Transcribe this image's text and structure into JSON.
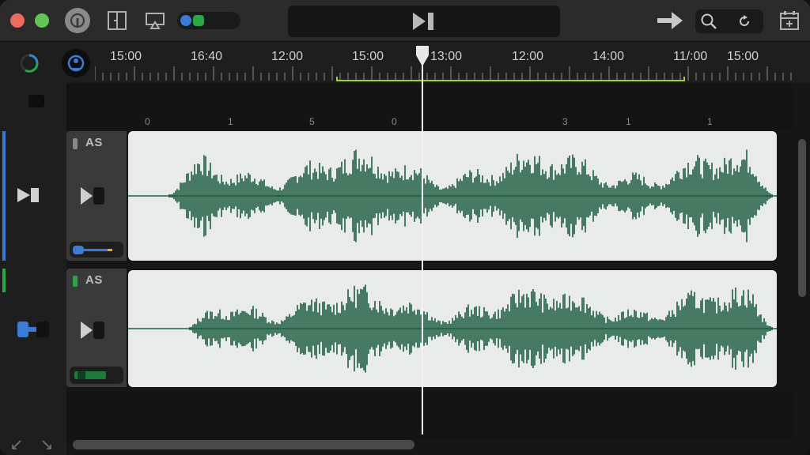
{
  "colors": {
    "close": "#ee6a5f",
    "minimize": "#f5bf4f",
    "zoom": "#61c554",
    "waveform": "#1e5e3f",
    "track1_accent": "#3a7bd5",
    "track2_accent": "#28a745",
    "cycle": "#9ad13a"
  },
  "toolbar": {
    "icons": [
      "library-icon",
      "smart-controls-icon",
      "airplay-icon",
      "track-toggle-icon",
      "play-pause-icon",
      "forward-arrow-icon",
      "search-icon",
      "refresh-icon",
      "add-track-icon"
    ]
  },
  "ruler": {
    "time_labels": [
      "15:00",
      "16:40",
      "12:00",
      "15:00",
      "13:00",
      "12:00",
      "14:00",
      "11/:00",
      "15:00"
    ],
    "beat_labels": [
      "0",
      "1",
      "5",
      "0",
      "3",
      "1",
      "1"
    ]
  },
  "tracks": [
    {
      "name": "AS",
      "accent": "blue",
      "level": 0.75
    },
    {
      "name": "AS",
      "accent": "green",
      "level": 0.55
    }
  ]
}
